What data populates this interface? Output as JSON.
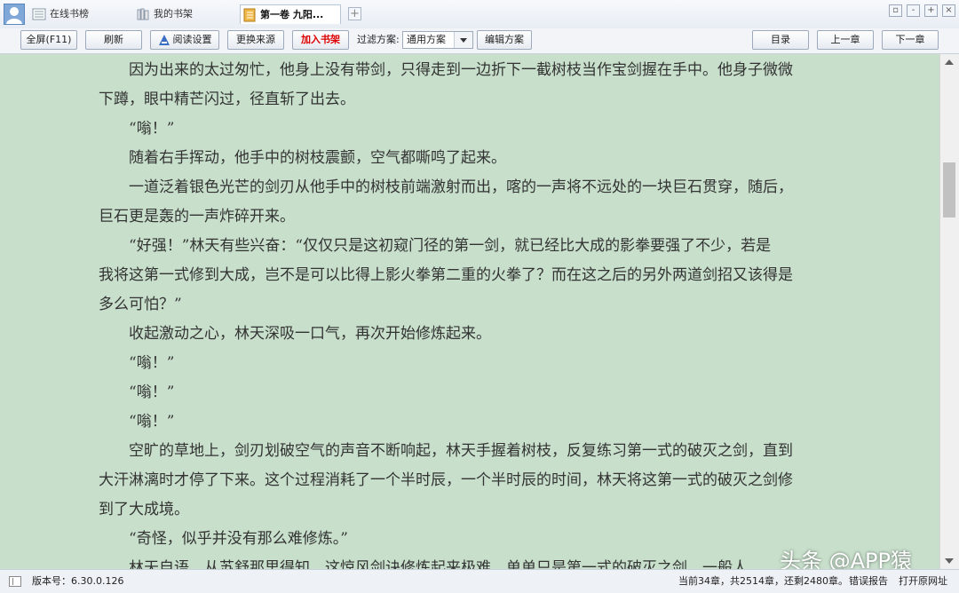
{
  "tabs": [
    {
      "label": "在线书榜",
      "icon": "list-icon"
    },
    {
      "label": "我的书架",
      "icon": "bookshelf-icon"
    },
    {
      "label": "第一卷 九阳...",
      "icon": "book-icon",
      "active": true
    }
  ],
  "tab_add": "+",
  "window_buttons": {
    "restore": "▫",
    "minimize": "-",
    "maximize": "+",
    "close": "×"
  },
  "toolbar": {
    "fullscreen": "全屏(F11)",
    "refresh": "刷新",
    "reading_settings": "阅读设置",
    "change_source": "更换来源",
    "add_to_shelf": "加入书架",
    "filter_label": "过滤方案:",
    "filter_value": "通用方案",
    "edit_filter": "编辑方案",
    "toc": "目录",
    "prev_chapter": "上一章",
    "next_chapter": "下一章"
  },
  "content": {
    "lines": [
      "　　因为出来的太过匆忙，他身上没有带剑，只得走到一边折下一截树枝当作宝剑握在手中。他身子微微",
      "下蹲，眼中精芒闪过，径直斩了出去。",
      "　　“嗡！”",
      "　　随着右手挥动，他手中的树枝震颤，空气都嘶鸣了起来。",
      "　　一道泛着银色光芒的剑刃从他手中的树枝前端激射而出，喀的一声将不远处的一块巨石贯穿，随后，",
      "巨石更是轰的一声炸碎开来。",
      "　　“好强！”林天有些兴奋：“仅仅只是这初窥门径的第一剑，就已经比大成的影拳要强了不少，若是",
      "我将这第一式修到大成，岂不是可以比得上影火拳第二重的火拳了？而在这之后的另外两道剑招又该得是",
      "多么可怕？”",
      "　　收起激动之心，林天深吸一口气，再次开始修炼起来。",
      "　　“嗡！”",
      "　　“嗡！”",
      "　　“嗡！”",
      "　　空旷的草地上，剑刃划破空气的声音不断响起，林天手握着树枝，反复练习第一式的破灭之剑，直到",
      "大汗淋漓时才停了下来。这个过程消耗了一个半时辰，一个半时辰的时间，林天将这第一式的破灭之剑修",
      "到了大成境。",
      "　　“奇怪，似乎并没有那么难修炼。”",
      "　　林天自语，从苏舒那里得知，这惊风剑诀修炼起来极难，单单只是第一式的破灭之剑，一般人"
    ]
  },
  "statusbar": {
    "version": "版本号：6.30.0.126",
    "progress": "当前34章，共2514章，还剩2480章。",
    "report_error": "错误报告",
    "open_source_url": "打开原网址"
  },
  "watermark": "头条 @APP猿",
  "colors": {
    "reader_bg": "#c7dfcb",
    "text": "#333333",
    "accent_red": "#dd0000"
  }
}
